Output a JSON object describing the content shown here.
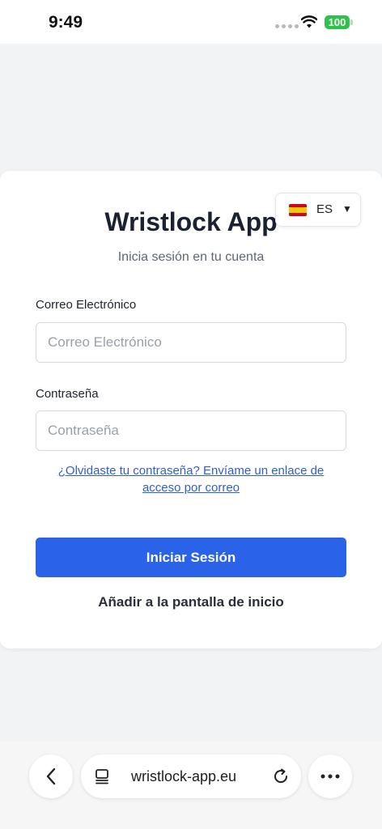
{
  "status_bar": {
    "time": "9:49",
    "battery": "100"
  },
  "login": {
    "app_title": "Wristlock App",
    "subtitle": "Inicia sesión en tu cuenta",
    "language": {
      "code": "ES",
      "flag": "spain-flag-icon"
    },
    "email": {
      "label": "Correo Electrónico",
      "placeholder": "Correo Electrónico",
      "value": ""
    },
    "password": {
      "label": "Contraseña",
      "placeholder": "Contraseña",
      "value": ""
    },
    "forgot_link": "¿Olvidaste tu contraseña? Envíame un enlace de acceso por correo",
    "submit_label": "Iniciar Sesión",
    "add_home_label": "Añadir a la pantalla de inicio"
  },
  "browser": {
    "url": "wristlock-app.eu",
    "icons": [
      "back-arrow-icon",
      "tabs-icon",
      "reload-icon",
      "more-icon"
    ]
  },
  "colors": {
    "primary": "#2b63e8",
    "link": "#2f5fcf",
    "battery": "#2fc24a"
  }
}
